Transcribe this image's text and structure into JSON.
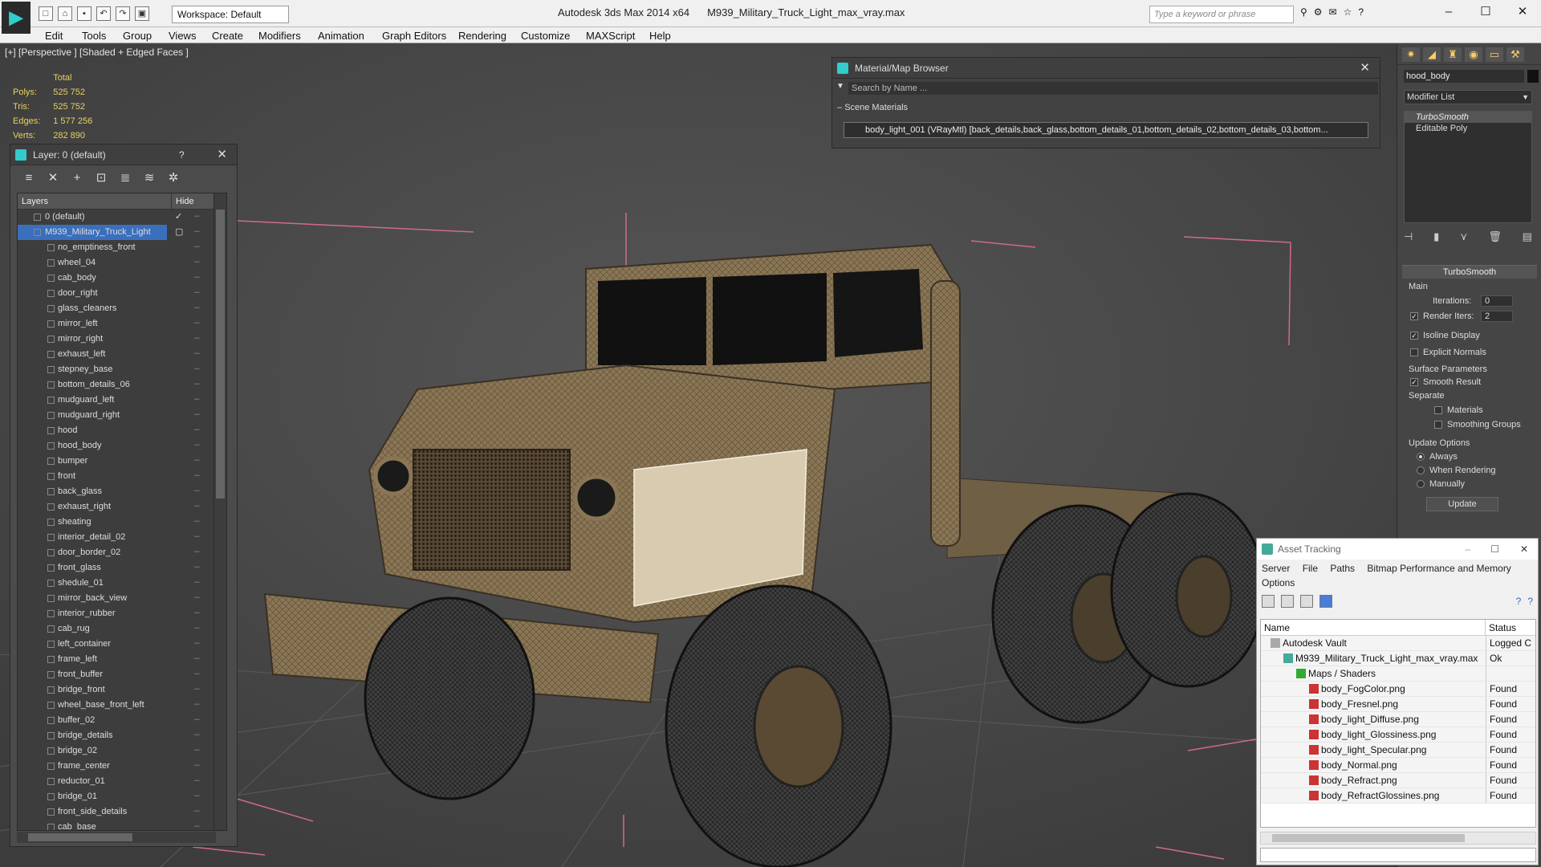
{
  "app": {
    "name": "Autodesk 3ds Max  2014 x64",
    "file": "M939_Military_Truck_Light_max_vray.max",
    "workspace": "Workspace: Default",
    "search_placeholder": "Type a keyword or phrase"
  },
  "menu": [
    "Edit",
    "Tools",
    "Group",
    "Views",
    "Create",
    "Modifiers",
    "Animation",
    "Graph Editors",
    "Rendering",
    "Customize",
    "MAXScript",
    "Help"
  ],
  "viewport": {
    "label": "[+] [Perspective ] [Shaded + Edged Faces ]",
    "stats": {
      "header": "Total",
      "rows": [
        {
          "label": "Polys:",
          "value": "525 752"
        },
        {
          "label": "Tris:",
          "value": "525 752"
        },
        {
          "label": "Edges:",
          "value": "1 577 256"
        },
        {
          "label": "Verts:",
          "value": "282 890"
        }
      ]
    }
  },
  "layer_panel": {
    "title": "Layer: 0 (default)",
    "help": "?",
    "col_layers": "Layers",
    "col_hide": "Hide",
    "default_layer": "0 (default)",
    "selected_layer": "M939_Military_Truck_Light",
    "items": [
      "no_emptiness_front",
      "wheel_04",
      "cab_body",
      "door_right",
      "glass_cleaners",
      "mirror_left",
      "mirror_right",
      "exhaust_left",
      "stepney_base",
      "bottom_details_06",
      "mudguard_left",
      "mudguard_right",
      "hood",
      "hood_body",
      "bumper",
      "front",
      "back_glass",
      "exhaust_right",
      "sheating",
      "interior_detail_02",
      "door_border_02",
      "front_glass",
      "shedule_01",
      "mirror_back_view",
      "interior_rubber",
      "cab_rug",
      "left_container",
      "frame_left",
      "front_buffer",
      "bridge_front",
      "wheel_base_front_left",
      "buffer_02",
      "bridge_details",
      "bridge_02",
      "frame_center",
      "reductor_01",
      "bridge_01",
      "front_side_details",
      "cab_base"
    ]
  },
  "material_browser": {
    "title": "Material/Map Browser",
    "search_placeholder": "Search by Name ...",
    "section": "Scene Materials",
    "entry": "body_light_001 (VRayMtl) [back_details,back_glass,bottom_details_01,bottom_details_02,bottom_details_03,bottom..."
  },
  "command_panel": {
    "object_name": "hood_body",
    "modifier_list": "Modifier List",
    "stack": [
      "TurboSmooth",
      "Editable Poly"
    ],
    "rollout_title": "TurboSmooth",
    "main": "Main",
    "iterations_label": "Iterations:",
    "iterations": "0",
    "render_iters_label": "Render Iters:",
    "render_iters": "2",
    "isoline": "Isoline Display",
    "explicit_normals": "Explicit Normals",
    "surface_params": "Surface Parameters",
    "smooth_result": "Smooth Result",
    "separate": "Separate",
    "materials": "Materials",
    "smoothing_groups": "Smoothing Groups",
    "update_options": "Update Options",
    "always": "Always",
    "when_rendering": "When Rendering",
    "manually": "Manually",
    "update_btn": "Update"
  },
  "asset_tracking": {
    "title": "Asset Tracking",
    "menu": [
      "Server",
      "File",
      "Paths",
      "Bitmap Performance and Memory",
      "Options"
    ],
    "col_name": "Name",
    "col_status": "Status",
    "rows": [
      {
        "name": "Autodesk Vault",
        "status": "Logged C",
        "indent": 1,
        "icon": "vault"
      },
      {
        "name": "M939_Military_Truck_Light_max_vray.max",
        "status": "Ok",
        "indent": 2,
        "icon": "max"
      },
      {
        "name": "Maps / Shaders",
        "status": "",
        "indent": 3,
        "icon": "folder"
      },
      {
        "name": "body_FogColor.png",
        "status": "Found",
        "indent": 4,
        "icon": "png"
      },
      {
        "name": "body_Fresnel.png",
        "status": "Found",
        "indent": 4,
        "icon": "png"
      },
      {
        "name": "body_light_Diffuse.png",
        "status": "Found",
        "indent": 4,
        "icon": "png"
      },
      {
        "name": "body_light_Glossiness.png",
        "status": "Found",
        "indent": 4,
        "icon": "png"
      },
      {
        "name": "body_light_Specular.png",
        "status": "Found",
        "indent": 4,
        "icon": "png"
      },
      {
        "name": "body_Normal.png",
        "status": "Found",
        "indent": 4,
        "icon": "png"
      },
      {
        "name": "body_Refract.png",
        "status": "Found",
        "indent": 4,
        "icon": "png"
      },
      {
        "name": "body_RefractGlossines.png",
        "status": "Found",
        "indent": 4,
        "icon": "png"
      }
    ]
  }
}
